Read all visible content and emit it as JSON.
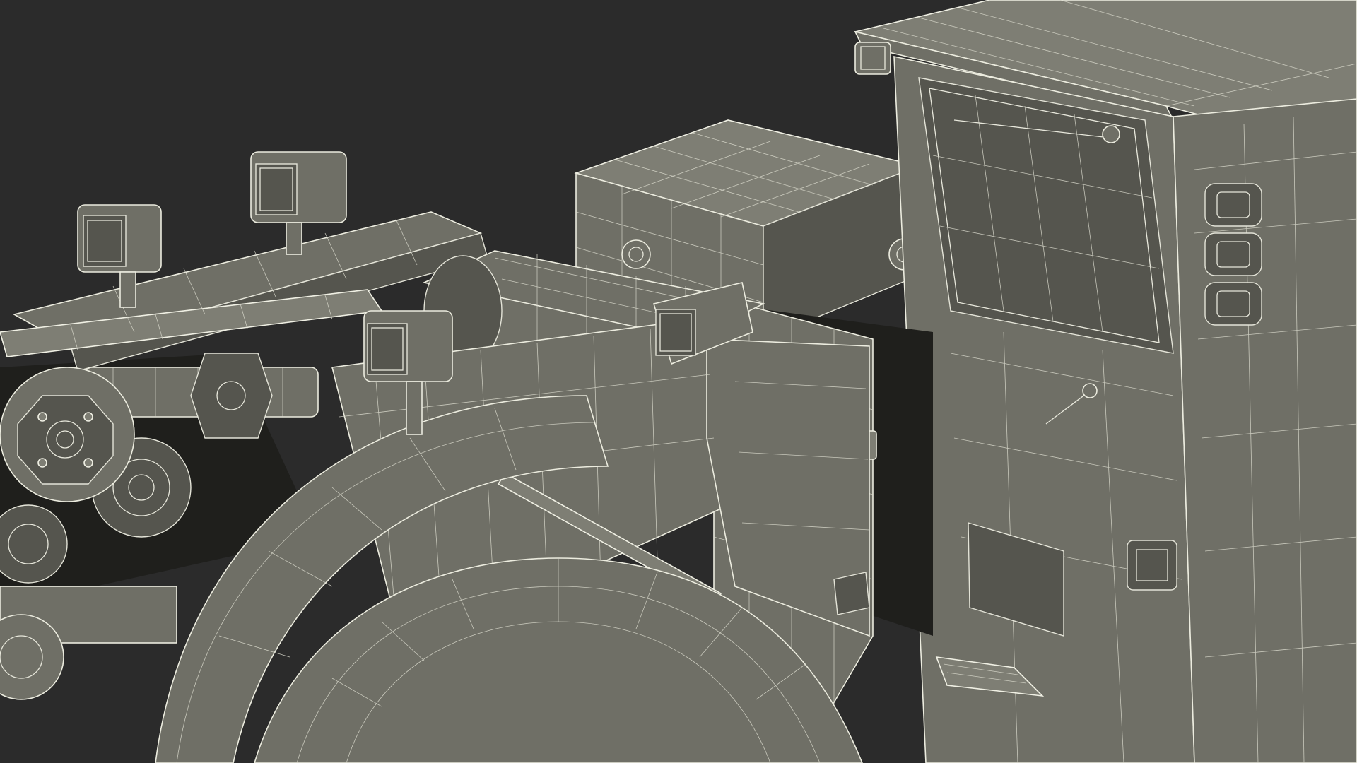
{
  "scene": {
    "subject": "wireframe-render-underground-loader",
    "background_color": "#2b2b2b",
    "surface_color": "#6f6f66",
    "wire_color": "#e8e8dc"
  }
}
